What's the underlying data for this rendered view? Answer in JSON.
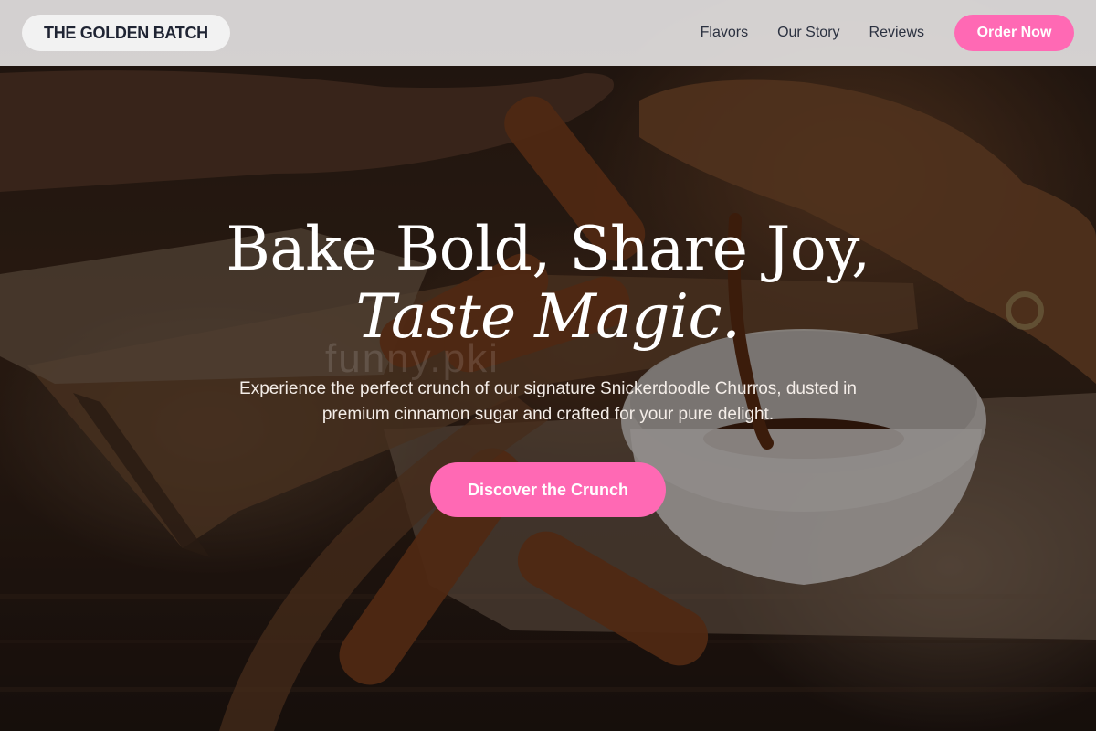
{
  "brand": {
    "name": "THE GOLDEN BATCH"
  },
  "nav": {
    "links": [
      "Flavors",
      "Our Story",
      "Reviews"
    ],
    "order_label": "Order Now"
  },
  "hero": {
    "headline_main": "Bake Bold, Share Joy,",
    "headline_emphasis": "Taste Magic.",
    "subtext": "Experience the perfect crunch of our signature Snickerdoodle Churros, dusted in premium cinnamon sugar and crafted for your pure delight.",
    "cta_label": "Discover the Crunch",
    "watermark": "funny.pki"
  },
  "colors": {
    "accent": "#ff69b4",
    "navbar_bg": "#e8e5e5",
    "brand_text": "#1f2433"
  }
}
